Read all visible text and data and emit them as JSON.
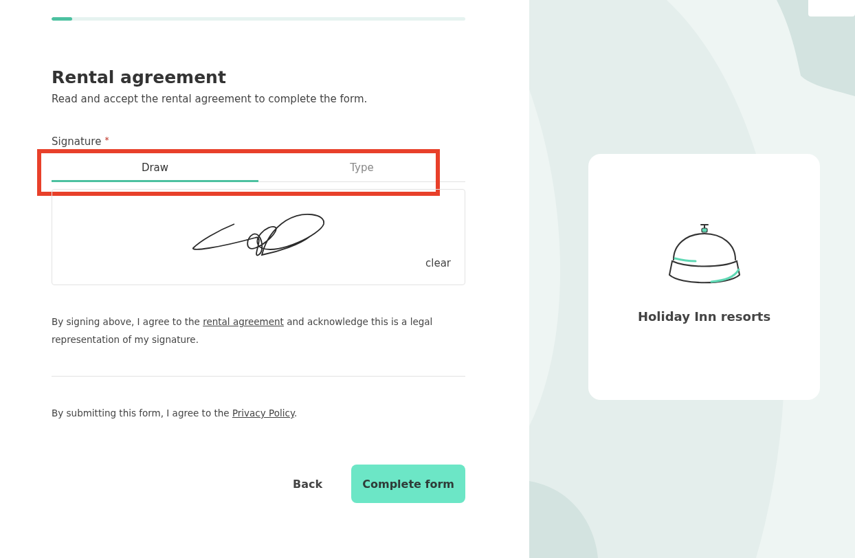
{
  "progress": {
    "level": 0.05
  },
  "heading": "Rental agreement",
  "subtitle": "Read and accept the rental agreement to complete the form.",
  "signature": {
    "label": "Signature",
    "required_mark": "*",
    "tabs": [
      {
        "label": "Draw",
        "selected": true
      },
      {
        "label": "Type",
        "selected": false
      }
    ],
    "clear": "clear"
  },
  "consent": {
    "before": "By signing above, I agree to the ",
    "link": "rental agreement",
    "after": " and acknowledge this is a legal representation of my signature."
  },
  "privacy": {
    "before": "By submitting this form, I agree to the ",
    "link": "Privacy Policy",
    "after": "."
  },
  "buttons": {
    "back": "Back",
    "submit": "Complete form"
  },
  "brand": {
    "name": "Holiday Inn resorts"
  }
}
